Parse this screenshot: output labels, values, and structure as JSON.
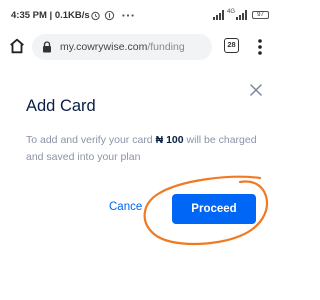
{
  "status_bar": {
    "time_speed": "4:35 PM | 0.1KB/s",
    "signal_label": "4G",
    "battery": "97"
  },
  "browser": {
    "url_host": "my.cowrywise.com",
    "url_path": "/funding",
    "tab_count": "28"
  },
  "dialog": {
    "title": "Add Card",
    "body_before": "To add and verify your card ",
    "amount": "₦ 100",
    "body_after": " will be charged and saved into your plan",
    "cancel_label": "Cance",
    "proceed_label": "Proceed"
  },
  "colors": {
    "accent": "#0066f5",
    "title": "#0a1f44",
    "body_text": "#8a94a6",
    "annotation": "#f07a22"
  }
}
